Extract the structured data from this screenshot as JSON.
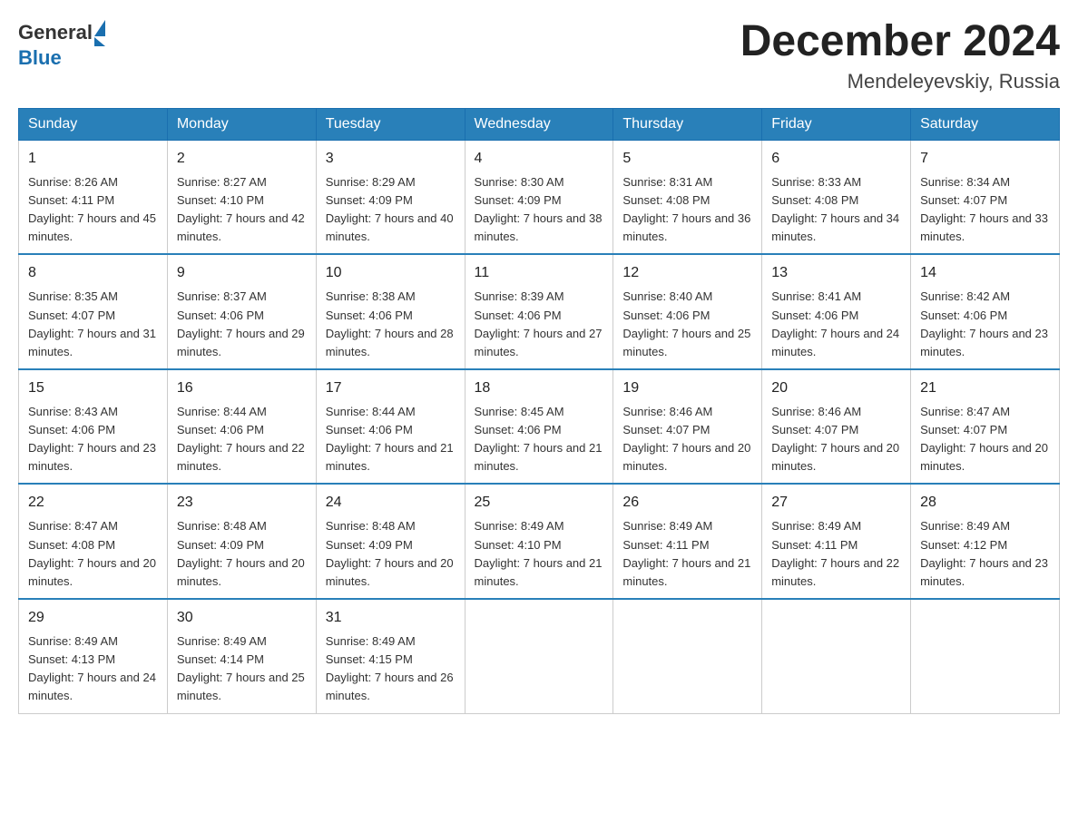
{
  "logo": {
    "text_general": "General",
    "text_blue": "Blue"
  },
  "title": {
    "month_year": "December 2024",
    "location": "Mendeleyevskiy, Russia"
  },
  "weekdays": [
    "Sunday",
    "Monday",
    "Tuesday",
    "Wednesday",
    "Thursday",
    "Friday",
    "Saturday"
  ],
  "weeks": [
    [
      {
        "day": "1",
        "sunrise": "8:26 AM",
        "sunset": "4:11 PM",
        "daylight": "7 hours and 45 minutes."
      },
      {
        "day": "2",
        "sunrise": "8:27 AM",
        "sunset": "4:10 PM",
        "daylight": "7 hours and 42 minutes."
      },
      {
        "day": "3",
        "sunrise": "8:29 AM",
        "sunset": "4:09 PM",
        "daylight": "7 hours and 40 minutes."
      },
      {
        "day": "4",
        "sunrise": "8:30 AM",
        "sunset": "4:09 PM",
        "daylight": "7 hours and 38 minutes."
      },
      {
        "day": "5",
        "sunrise": "8:31 AM",
        "sunset": "4:08 PM",
        "daylight": "7 hours and 36 minutes."
      },
      {
        "day": "6",
        "sunrise": "8:33 AM",
        "sunset": "4:08 PM",
        "daylight": "7 hours and 34 minutes."
      },
      {
        "day": "7",
        "sunrise": "8:34 AM",
        "sunset": "4:07 PM",
        "daylight": "7 hours and 33 minutes."
      }
    ],
    [
      {
        "day": "8",
        "sunrise": "8:35 AM",
        "sunset": "4:07 PM",
        "daylight": "7 hours and 31 minutes."
      },
      {
        "day": "9",
        "sunrise": "8:37 AM",
        "sunset": "4:06 PM",
        "daylight": "7 hours and 29 minutes."
      },
      {
        "day": "10",
        "sunrise": "8:38 AM",
        "sunset": "4:06 PM",
        "daylight": "7 hours and 28 minutes."
      },
      {
        "day": "11",
        "sunrise": "8:39 AM",
        "sunset": "4:06 PM",
        "daylight": "7 hours and 27 minutes."
      },
      {
        "day": "12",
        "sunrise": "8:40 AM",
        "sunset": "4:06 PM",
        "daylight": "7 hours and 25 minutes."
      },
      {
        "day": "13",
        "sunrise": "8:41 AM",
        "sunset": "4:06 PM",
        "daylight": "7 hours and 24 minutes."
      },
      {
        "day": "14",
        "sunrise": "8:42 AM",
        "sunset": "4:06 PM",
        "daylight": "7 hours and 23 minutes."
      }
    ],
    [
      {
        "day": "15",
        "sunrise": "8:43 AM",
        "sunset": "4:06 PM",
        "daylight": "7 hours and 23 minutes."
      },
      {
        "day": "16",
        "sunrise": "8:44 AM",
        "sunset": "4:06 PM",
        "daylight": "7 hours and 22 minutes."
      },
      {
        "day": "17",
        "sunrise": "8:44 AM",
        "sunset": "4:06 PM",
        "daylight": "7 hours and 21 minutes."
      },
      {
        "day": "18",
        "sunrise": "8:45 AM",
        "sunset": "4:06 PM",
        "daylight": "7 hours and 21 minutes."
      },
      {
        "day": "19",
        "sunrise": "8:46 AM",
        "sunset": "4:07 PM",
        "daylight": "7 hours and 20 minutes."
      },
      {
        "day": "20",
        "sunrise": "8:46 AM",
        "sunset": "4:07 PM",
        "daylight": "7 hours and 20 minutes."
      },
      {
        "day": "21",
        "sunrise": "8:47 AM",
        "sunset": "4:07 PM",
        "daylight": "7 hours and 20 minutes."
      }
    ],
    [
      {
        "day": "22",
        "sunrise": "8:47 AM",
        "sunset": "4:08 PM",
        "daylight": "7 hours and 20 minutes."
      },
      {
        "day": "23",
        "sunrise": "8:48 AM",
        "sunset": "4:09 PM",
        "daylight": "7 hours and 20 minutes."
      },
      {
        "day": "24",
        "sunrise": "8:48 AM",
        "sunset": "4:09 PM",
        "daylight": "7 hours and 20 minutes."
      },
      {
        "day": "25",
        "sunrise": "8:49 AM",
        "sunset": "4:10 PM",
        "daylight": "7 hours and 21 minutes."
      },
      {
        "day": "26",
        "sunrise": "8:49 AM",
        "sunset": "4:11 PM",
        "daylight": "7 hours and 21 minutes."
      },
      {
        "day": "27",
        "sunrise": "8:49 AM",
        "sunset": "4:11 PM",
        "daylight": "7 hours and 22 minutes."
      },
      {
        "day": "28",
        "sunrise": "8:49 AM",
        "sunset": "4:12 PM",
        "daylight": "7 hours and 23 minutes."
      }
    ],
    [
      {
        "day": "29",
        "sunrise": "8:49 AM",
        "sunset": "4:13 PM",
        "daylight": "7 hours and 24 minutes."
      },
      {
        "day": "30",
        "sunrise": "8:49 AM",
        "sunset": "4:14 PM",
        "daylight": "7 hours and 25 minutes."
      },
      {
        "day": "31",
        "sunrise": "8:49 AM",
        "sunset": "4:15 PM",
        "daylight": "7 hours and 26 minutes."
      },
      null,
      null,
      null,
      null
    ]
  ]
}
